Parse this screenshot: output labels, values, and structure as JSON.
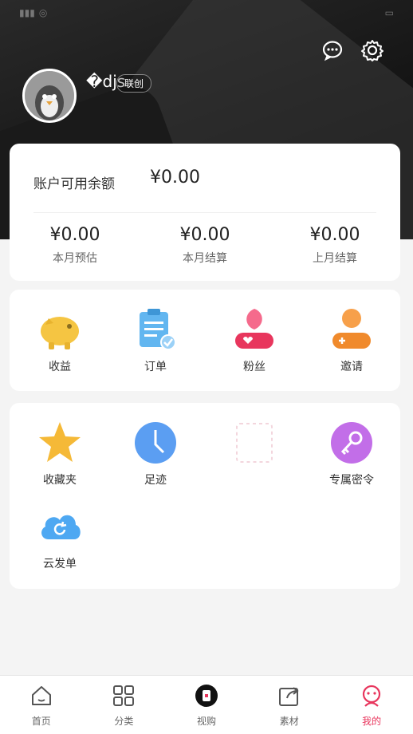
{
  "user": {
    "name": "�djs",
    "badge": "联创"
  },
  "balance": {
    "label": "账户可用余额",
    "value": "¥0.00"
  },
  "stats": [
    {
      "value": "¥0.00",
      "label": "本月预估"
    },
    {
      "value": "¥0.00",
      "label": "本月结算"
    },
    {
      "value": "¥0.00",
      "label": "上月结算"
    }
  ],
  "grid1": [
    {
      "label": "收益",
      "icon": "piggy-bank-icon"
    },
    {
      "label": "订单",
      "icon": "clipboard-icon"
    },
    {
      "label": "粉丝",
      "icon": "fan-person-icon"
    },
    {
      "label": "邀请",
      "icon": "invite-person-icon"
    }
  ],
  "grid2": [
    {
      "label": "收藏夹",
      "icon": "star-icon"
    },
    {
      "label": "足迹",
      "icon": "clock-icon"
    },
    {
      "label": "专属密令",
      "icon": "key-icon"
    },
    {
      "label": "云发单",
      "icon": "cloud-icon"
    }
  ],
  "tabs": [
    {
      "label": "首页",
      "icon": "home-icon"
    },
    {
      "label": "分类",
      "icon": "grid-icon"
    },
    {
      "label": "视购",
      "icon": "video-icon"
    },
    {
      "label": "素材",
      "icon": "share-icon"
    },
    {
      "label": "我的",
      "icon": "profile-icon",
      "active": true
    }
  ],
  "colors": {
    "accent": "#e8365d",
    "header": "#1a1a1a"
  }
}
